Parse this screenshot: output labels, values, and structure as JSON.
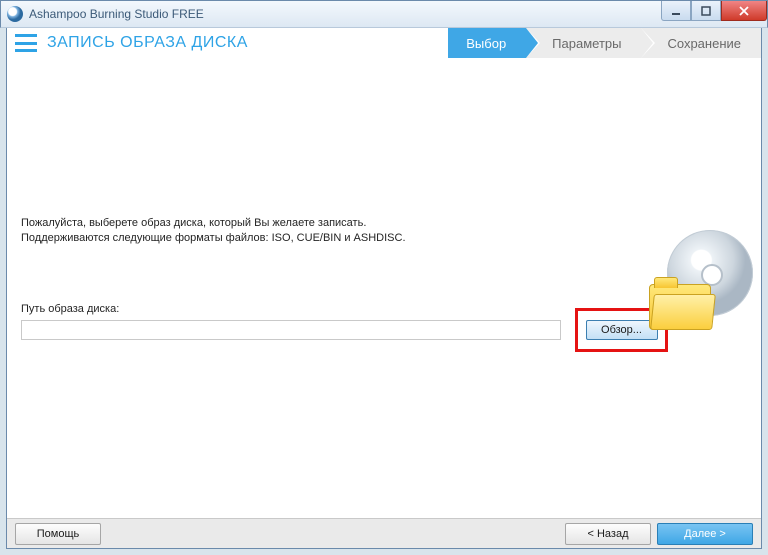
{
  "window": {
    "title": "Ashampoo Burning Studio FREE"
  },
  "header": {
    "page_title": "ЗАПИСЬ ОБРАЗА ДИСКА"
  },
  "steps": [
    {
      "label": "Выбор",
      "active": true
    },
    {
      "label": "Параметры",
      "active": false
    },
    {
      "label": "Сохранение",
      "active": false
    }
  ],
  "main": {
    "instruction_line1": "Пожалуйста, выберете образ диска, который Вы желаете записать.",
    "instruction_line2": "Поддерживаются следующие форматы файлов: ISO, CUE/BIN и ASHDISC.",
    "path_label": "Путь образа диска:",
    "path_value": "",
    "browse_label": "Обзор..."
  },
  "footer": {
    "help": "Помощь",
    "back": "< Назад",
    "next": "Далее >"
  }
}
